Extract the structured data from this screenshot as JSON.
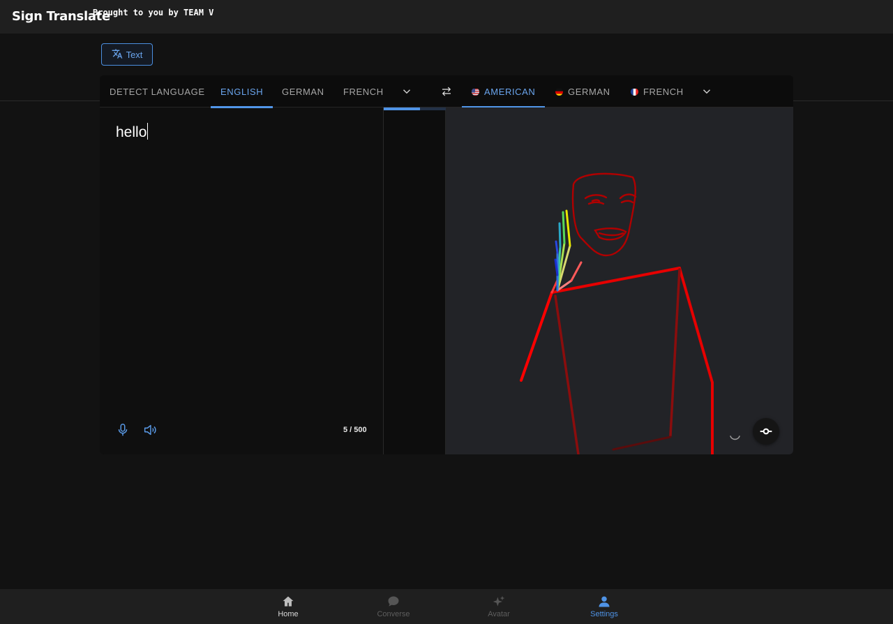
{
  "header": {
    "title": "Sign Translate",
    "tagline": "Brought to you by TEAM V"
  },
  "mode": {
    "label": "Text",
    "icon": "translate-icon"
  },
  "spoken_tabs": [
    {
      "label": "DETECT LANGUAGE",
      "active": false
    },
    {
      "label": "ENGLISH",
      "active": true
    },
    {
      "label": "GERMAN",
      "active": false
    },
    {
      "label": "FRENCH",
      "active": false
    }
  ],
  "signed_tabs": [
    {
      "label": "AMERICAN",
      "flag": "us-flag",
      "active": true
    },
    {
      "label": "GERMAN",
      "flag": "de-flag",
      "active": false
    },
    {
      "label": "FRENCH",
      "flag": "fr-flag",
      "active": false
    }
  ],
  "input": {
    "text": "hello",
    "char_count": "5 / 500"
  },
  "translation_progress": 0.58,
  "bottom_nav": [
    {
      "label": "Home",
      "icon": "home-icon",
      "state": "default"
    },
    {
      "label": "Converse",
      "icon": "chat-icon",
      "state": "disabled"
    },
    {
      "label": "Avatar",
      "icon": "sparkle-icon",
      "state": "disabled"
    },
    {
      "label": "Settings",
      "icon": "person-icon",
      "state": "active"
    }
  ],
  "colors": {
    "accent": "#4f93e6",
    "pose_body": "#e60000",
    "pose_face": "#b00000"
  }
}
